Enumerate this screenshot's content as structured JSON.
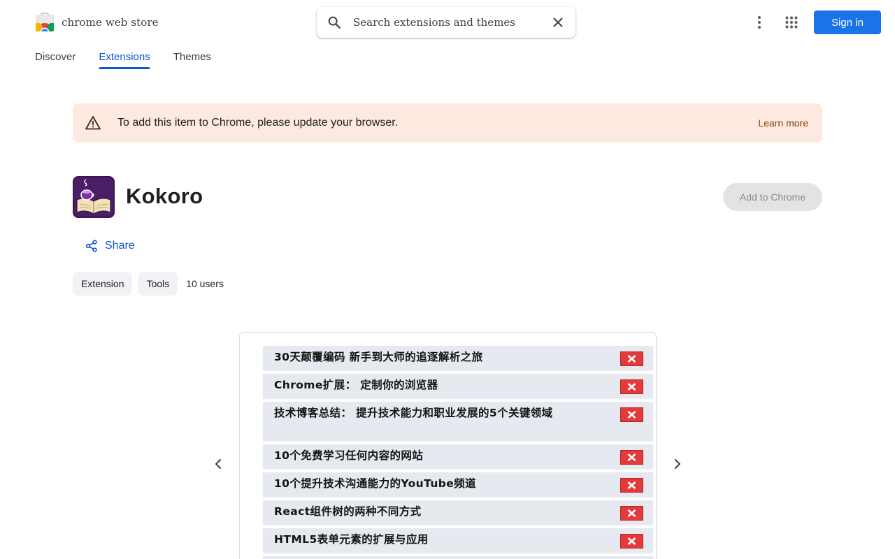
{
  "header": {
    "store_name": "chrome web store",
    "search_placeholder": "Search extensions and themes",
    "sign_in_label": "Sign in"
  },
  "tabs": [
    {
      "label": "Discover",
      "active": false
    },
    {
      "label": "Extensions",
      "active": true
    },
    {
      "label": "Themes",
      "active": false
    }
  ],
  "banner": {
    "message": "To add this item to Chrome, please update your browser.",
    "learn_more": "Learn more",
    "icon": "warning-icon"
  },
  "item": {
    "title": "Kokoro",
    "add_label": "Add to Chrome",
    "share_label": "Share",
    "chips": [
      "Extension",
      "Tools"
    ],
    "users": "10 users"
  },
  "screenshot": {
    "rows": [
      "30天颠覆编码 新手到大师的追逐解析之旅",
      "Chrome扩展： 定制你的浏览器",
      "技术博客总结： 提升技术能力和职业发展的5个关键领域",
      "10个免费学习任何内容的网站",
      "10个提升技术沟通能力的YouTube频道",
      "React组件树的两种不同方式",
      "HTML5表单元素的扩展与应用"
    ]
  },
  "colors": {
    "accent": "#0b57d0",
    "sign_in_bg": "#1a73e8",
    "banner_bg": "#fde9e0",
    "banner_link": "#8b3d00",
    "delete_red": "#e33b3b"
  }
}
